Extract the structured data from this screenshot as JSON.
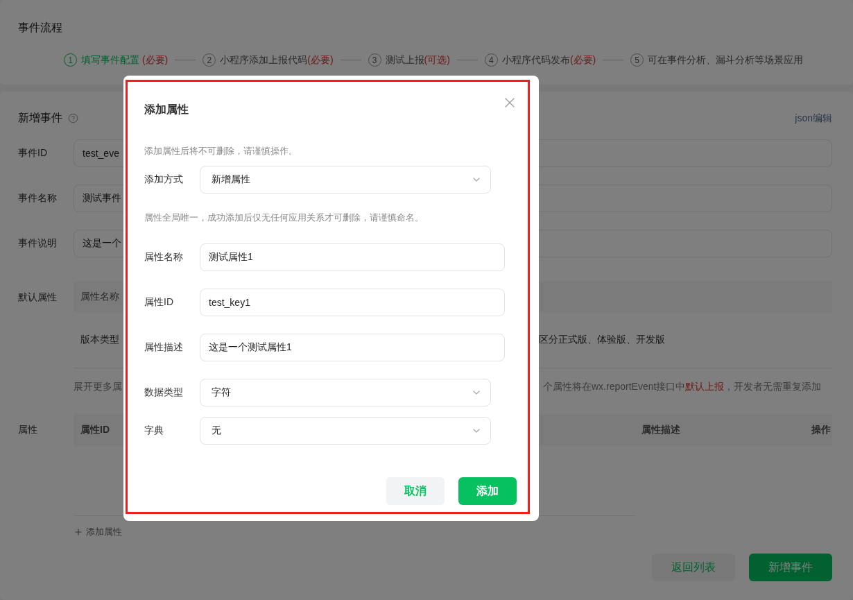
{
  "flow": {
    "title": "事件流程",
    "steps": [
      {
        "number": "1",
        "label": "填写事件配置 ",
        "tag": "(必要)",
        "selected": true
      },
      {
        "number": "2",
        "label": "小程序添加上报代码",
        "tag": "(必要)",
        "selected": false
      },
      {
        "number": "3",
        "label": "测试上报",
        "tag": "(可选)",
        "selected": false
      },
      {
        "number": "4",
        "label": "小程序代码发布",
        "tag": "(必要)",
        "selected": false
      },
      {
        "number": "5",
        "label": "可在事件分析、漏斗分析等场景应用",
        "selected": false
      }
    ]
  },
  "form": {
    "title": "新增事件",
    "json_link": "json编辑",
    "fields": [
      {
        "label": "事件ID",
        "value": "test_eve"
      },
      {
        "label": "事件名称",
        "value": "测试事件"
      },
      {
        "label": "事件说明",
        "value": "这是一个"
      }
    ]
  },
  "default_properties": {
    "label": "默认属性",
    "header": "属性名称",
    "rows": [
      {
        "left": "版本类型",
        "right": "区分正式版、体验版、开发版"
      }
    ],
    "note": {
      "left": "展开更多属",
      "right": "个属性将在wx.reportEvent接口中**默认上报**，开发者无需重复添加"
    }
  },
  "properties": {
    "label": "属性",
    "header_left": "属性ID",
    "header_right": [
      "属性描述",
      "操作"
    ],
    "add_link": "添加属性"
  },
  "actions": [
    {
      "label": "返回列表",
      "primary": false
    },
    {
      "label": "新增事件",
      "primary": true
    }
  ],
  "dialog": {
    "title": "添加属性",
    "rows": [
      {
        "kind": "hint",
        "text": "添加属性后将不可删除，请谨慎操作。"
      },
      {
        "kind": "select",
        "label": "添加方式",
        "value": "新增属性"
      },
      {
        "kind": "hint",
        "text": "属性全局唯一，成功添加后仅无任何应用关系才可删除，请谨慎命名。"
      },
      {
        "kind": "input",
        "label": "属性名称",
        "value": "测试属性1"
      },
      {
        "kind": "input",
        "label": "属性ID",
        "value": "test_key1"
      },
      {
        "kind": "input",
        "label": "属性描述",
        "value": "这是一个测试属性1"
      },
      {
        "kind": "select",
        "label": "数据类型",
        "value": "字符"
      },
      {
        "kind": "select",
        "label": "字典",
        "value": "无"
      }
    ],
    "buttons": [
      {
        "label": "取消",
        "primary": false
      },
      {
        "label": "添加",
        "primary": true
      }
    ]
  }
}
